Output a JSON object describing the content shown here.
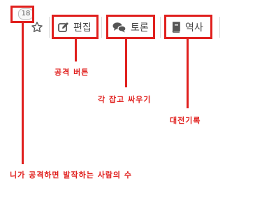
{
  "toolbar": {
    "view_count": "18",
    "edit_label": "편집",
    "discuss_label": "토론",
    "history_label": "역사"
  },
  "annotations": {
    "edit": "공격 버튼",
    "discuss": "각 잡고 싸우기",
    "history": "대전기록",
    "count": "니가 공격하면 발작하는 사람의 수"
  },
  "colors": {
    "annotation": "#e0201e",
    "icon": "#555555",
    "separator": "#dcdcdc"
  },
  "icons": {
    "star": "star-icon",
    "edit": "pencil-square-icon",
    "discuss": "chat-bubbles-icon",
    "history": "book-icon"
  }
}
